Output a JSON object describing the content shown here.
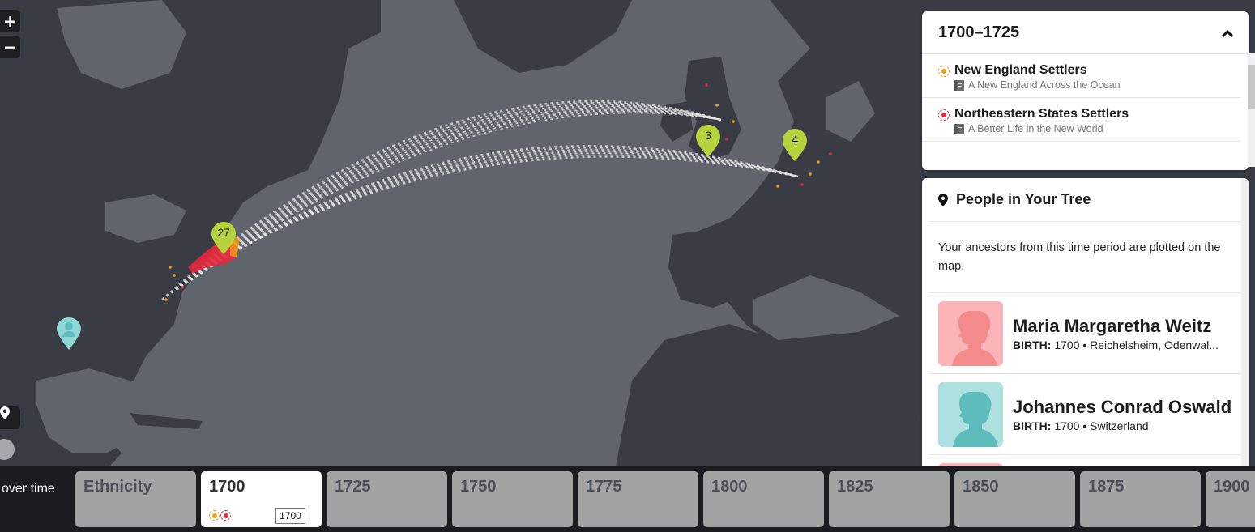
{
  "map": {
    "zoom_in_label": "+",
    "zoom_out_label": "−",
    "clusters": [
      {
        "name": "northeast-us",
        "count": "27"
      },
      {
        "name": "england",
        "count": "3"
      },
      {
        "name": "germany",
        "count": "4"
      }
    ],
    "colors": {
      "ocean": "#5f646d",
      "land": "#393c44",
      "cluster_pin": "#b5d33d",
      "person_pin": "#8fd6d6",
      "migration_red": "#e8283c",
      "migration_orange": "#f39c12"
    }
  },
  "period_panel": {
    "title": "1700–1725",
    "collapse_icon": "chevron-up-icon",
    "migrations": [
      {
        "name": "New England Settlers",
        "story": "A New England Across the Ocean",
        "color": "#f39c12"
      },
      {
        "name": "Northeastern States Settlers",
        "story": "A Better Life in the New World",
        "color": "#e8283c"
      }
    ]
  },
  "people_panel": {
    "title": "People in Your Tree",
    "description": "Your ancestors from this time period are plotted on the map.",
    "people": [
      {
        "name": "Maria Margaretha Weitz",
        "birth_label": "BIRTH:",
        "birth_detail": "1700 • Reichelsheim, Odenwal...",
        "gender": "female"
      },
      {
        "name": "Johannes Conrad Oswald",
        "birth_label": "BIRTH:",
        "birth_detail": "1700 • Switzerland",
        "gender": "male"
      }
    ]
  },
  "timeline": {
    "label": "over time",
    "cards": [
      {
        "label": "Ethnicity",
        "active": false
      },
      {
        "label": "1700",
        "active": true,
        "input_value": "1700"
      },
      {
        "label": "1725",
        "active": false
      },
      {
        "label": "1750",
        "active": false
      },
      {
        "label": "1775",
        "active": false
      },
      {
        "label": "1800",
        "active": false
      },
      {
        "label": "1825",
        "active": false
      },
      {
        "label": "1850",
        "active": false
      },
      {
        "label": "1875",
        "active": false
      },
      {
        "label": "1900",
        "active": false
      }
    ]
  }
}
